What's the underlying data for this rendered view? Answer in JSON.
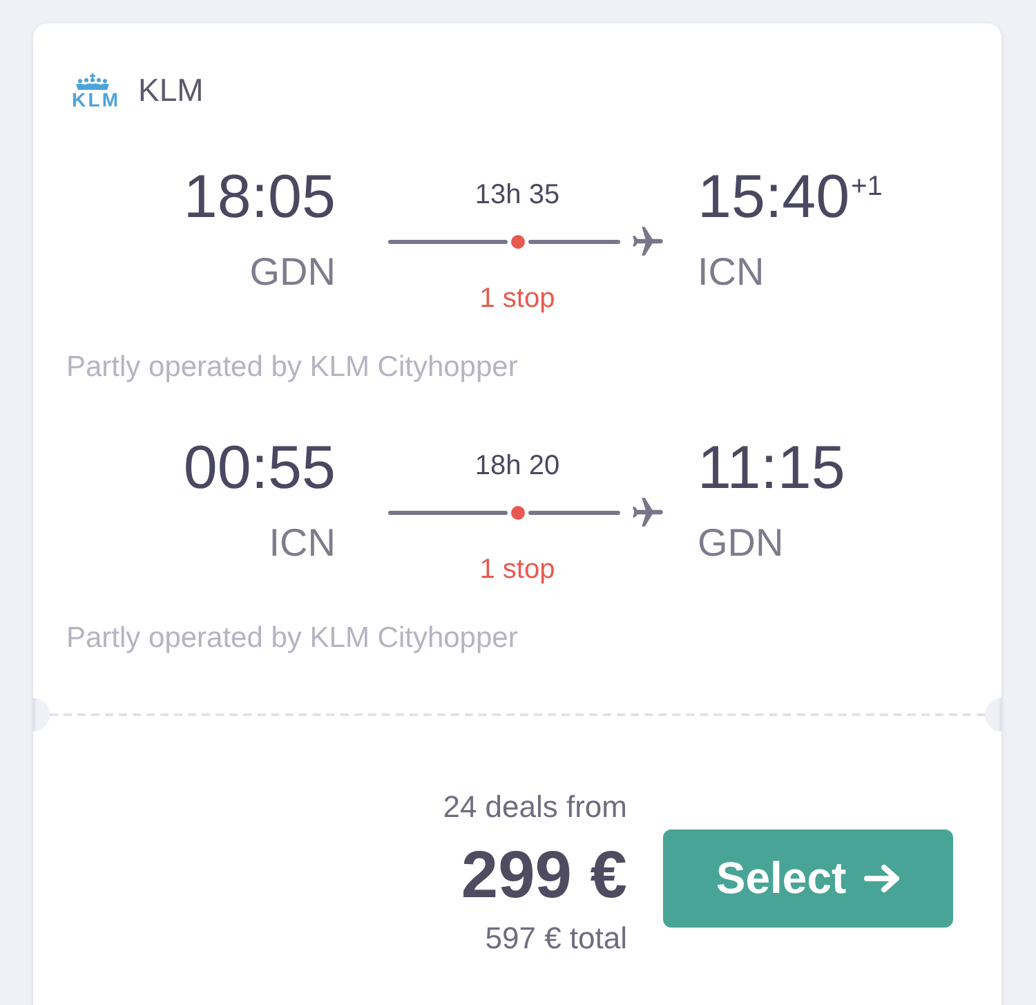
{
  "airline": {
    "logo_text": "KLM",
    "name": "KLM"
  },
  "legs": [
    {
      "departure_time": "18:05",
      "departure_airport": "GDN",
      "duration": "13h 35",
      "stops": "1 stop",
      "arrival_time": "15:40",
      "day_offset": "+1",
      "arrival_airport": "ICN",
      "operator_note": "Partly operated by KLM Cityhopper"
    },
    {
      "departure_time": "00:55",
      "departure_airport": "ICN",
      "duration": "18h 20",
      "stops": "1 stop",
      "arrival_time": "11:15",
      "arrival_airport": "GDN",
      "operator_note": "Partly operated by KLM Cityhopper"
    }
  ],
  "price": {
    "deals": "24 deals from",
    "amount": "299 €",
    "total": "597 € total"
  },
  "select_button": {
    "label": "Select"
  }
}
